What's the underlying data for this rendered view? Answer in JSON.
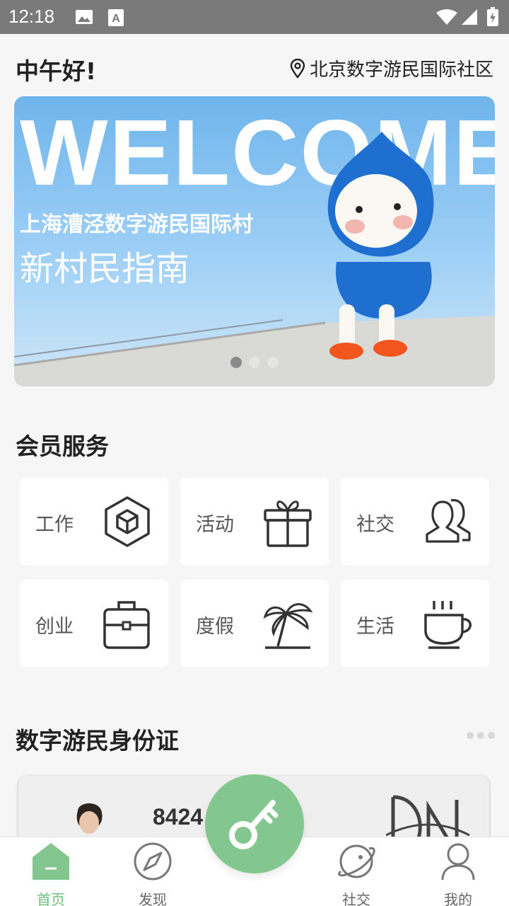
{
  "status_bar": {
    "time": "12:18"
  },
  "header": {
    "greeting": "中午好!",
    "location": "北京数字游民国际社区"
  },
  "banner": {
    "headline": "WELCOME",
    "subtitle": "上海漕泾数字游民国际村",
    "caption": "新村民指南",
    "active_slide": 1,
    "slide_count": 3
  },
  "member_services": {
    "title": "会员服务",
    "items": [
      {
        "label": "工作",
        "icon": "cube-icon"
      },
      {
        "label": "活动",
        "icon": "gift-icon"
      },
      {
        "label": "社交",
        "icon": "users-icon"
      },
      {
        "label": "创业",
        "icon": "briefcase-icon"
      },
      {
        "label": "度假",
        "icon": "palm-tree-icon"
      },
      {
        "label": "生活",
        "icon": "coffee-cup-icon"
      }
    ]
  },
  "id_section": {
    "title": "数字游民身份证",
    "card_number": "8424"
  },
  "bottom_nav": {
    "items": [
      {
        "label": "首页",
        "icon": "home-icon",
        "active": true
      },
      {
        "label": "发现",
        "icon": "compass-icon",
        "active": false
      },
      {
        "label": "社交",
        "icon": "planet-icon",
        "active": false
      },
      {
        "label": "我的",
        "icon": "user-icon",
        "active": false
      }
    ],
    "center_action": {
      "icon": "key-icon"
    }
  },
  "colors": {
    "accent": "#84c690",
    "active_nav": "#6cbf79",
    "status_bar": "#7a7a7a"
  }
}
